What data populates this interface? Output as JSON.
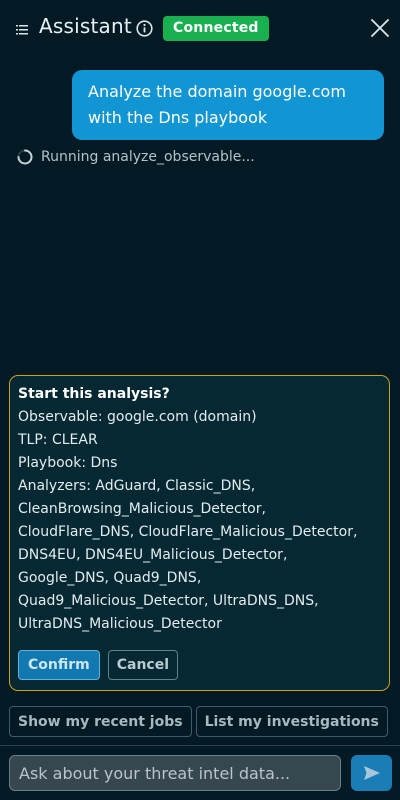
{
  "header": {
    "title": "Assistant",
    "status": "Connected"
  },
  "conversation": {
    "user_message": "Analyze the domain google.com with the Dns playbook",
    "running_text": "Running analyze_observable..."
  },
  "confirmation": {
    "title": "Start this analysis?",
    "lines": [
      "Observable: google.com (domain)",
      "TLP: CLEAR",
      "Playbook: Dns",
      "Analyzers: AdGuard, Classic_DNS,",
      "CleanBrowsing_Malicious_Detector,",
      "CloudFlare_DNS, CloudFlare_Malicious_Detector,",
      "DNS4EU, DNS4EU_Malicious_Detector,",
      "Google_DNS, Quad9_DNS,",
      "Quad9_Malicious_Detector, UltraDNS_DNS,",
      "UltraDNS_Malicious_Detector"
    ],
    "confirm_label": "Confirm",
    "cancel_label": "Cancel"
  },
  "suggestions": [
    "Show my recent jobs",
    "List my investigations"
  ],
  "composer": {
    "placeholder": "Ask about your threat intel data..."
  },
  "icons": {
    "menu": "list-icon",
    "info": "info-icon",
    "close": "close-icon",
    "spinner": "spinner-icon",
    "send": "send-icon"
  },
  "colors": {
    "background": "#031a24",
    "accent": "#1296d3",
    "status_connected": "#19b14f",
    "warning_border": "#c9a21e"
  }
}
